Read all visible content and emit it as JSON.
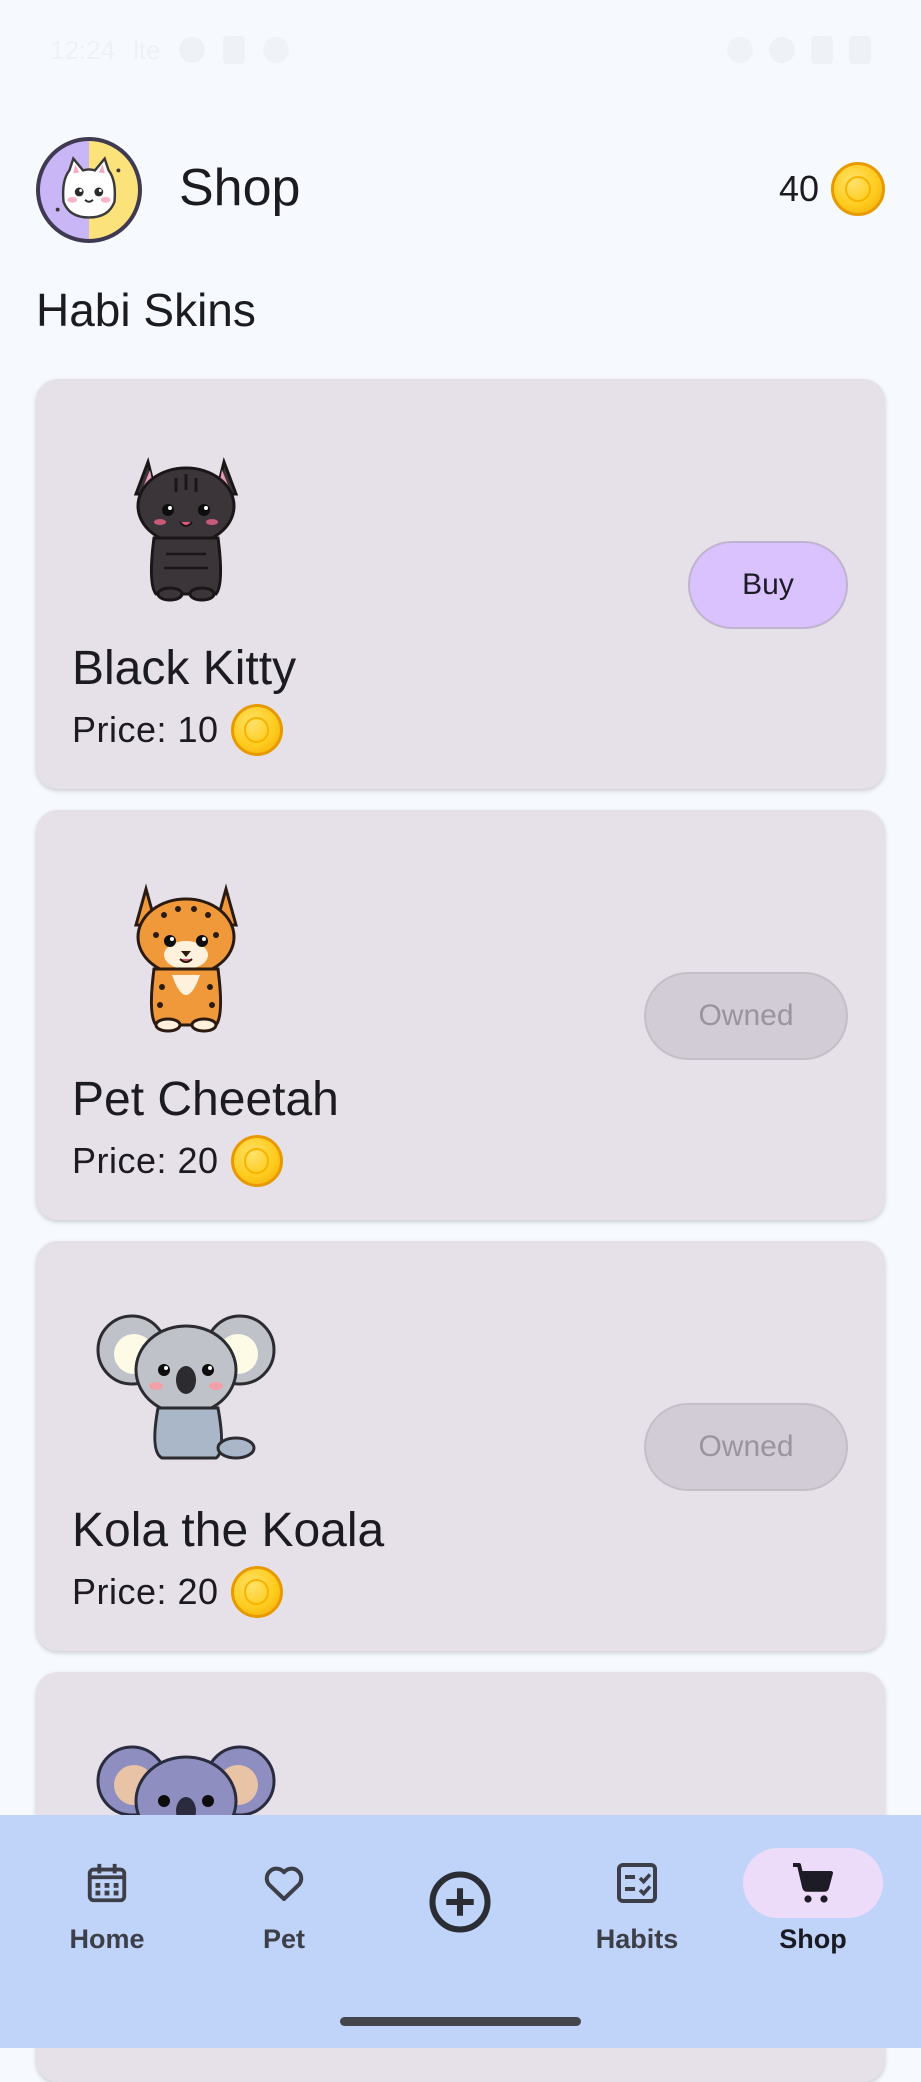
{
  "status_bar": {
    "time": "12:24",
    "carrier": "lte"
  },
  "header": {
    "title": "Shop",
    "coin_balance": "40"
  },
  "section": {
    "title": "Habi Skins"
  },
  "items": [
    {
      "name": "Black Kitty",
      "price_label": "Price: 10",
      "action": "Buy"
    },
    {
      "name": "Pet Cheetah",
      "price_label": "Price: 20",
      "action": "Owned"
    },
    {
      "name": "Kola the Koala",
      "price_label": "Price: 20",
      "action": "Owned"
    }
  ],
  "bottom_nav": {
    "items": [
      {
        "label": "Home",
        "icon": "calendar-icon"
      },
      {
        "label": "Pet",
        "icon": "heart-icon"
      },
      {
        "label": "",
        "icon": "add-circle-icon"
      },
      {
        "label": "Habits",
        "icon": "checklist-icon"
      },
      {
        "label": "Shop",
        "icon": "cart-icon"
      }
    ],
    "active": "Shop"
  },
  "colors": {
    "background": "#f6f9fd",
    "card": "#e6e0e9",
    "buy_button": "#d9c2fd",
    "owned_button": "#d2ccd6",
    "nav_bar": "#c0d3f9",
    "nav_active_pill": "#ecdcfa",
    "coin": "#ffcc1f"
  }
}
